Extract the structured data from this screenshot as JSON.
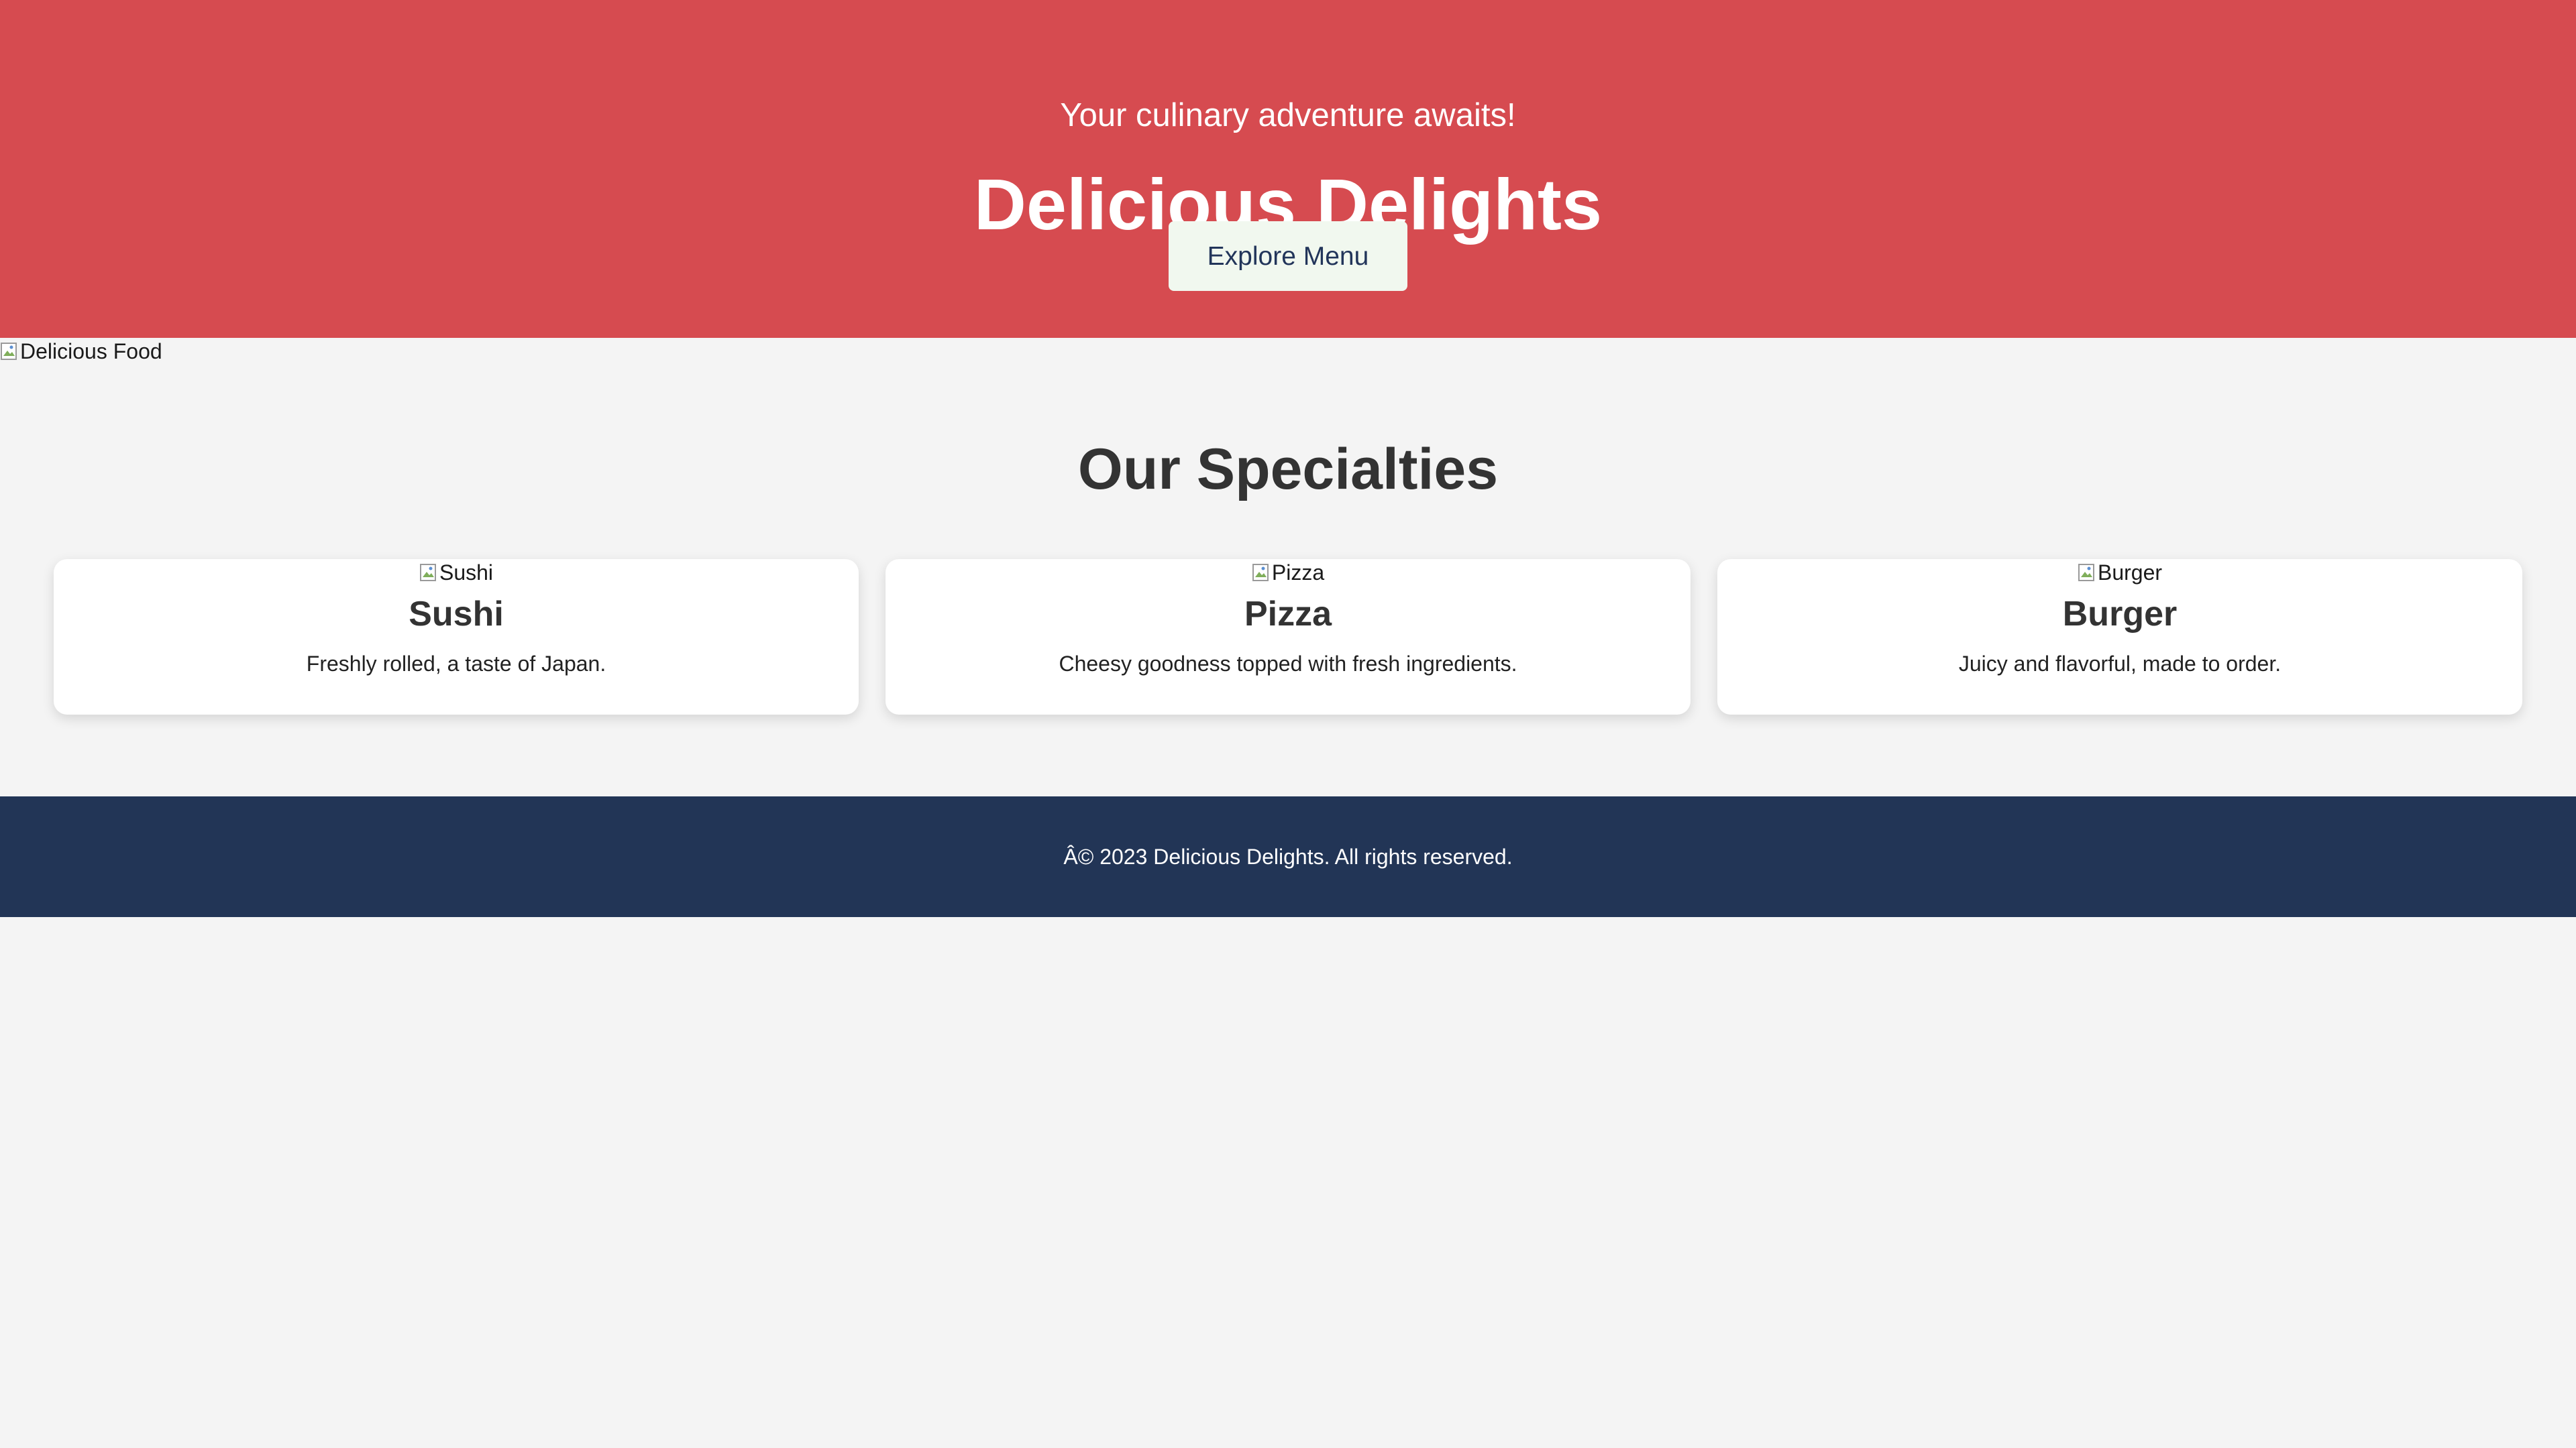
{
  "hero": {
    "tagline": "Your culinary adventure awaits!",
    "title": "Delicious Delights",
    "cta_label": "Explore Menu",
    "image_alt": "Delicious Food",
    "background_color": "#d64b50",
    "cta_background": "#f1f8ef",
    "cta_text_color": "#22355a"
  },
  "specialties": {
    "heading": "Our Specialties",
    "items": [
      {
        "image_alt": "Sushi",
        "name": "Sushi",
        "description": "Freshly rolled, a taste of Japan."
      },
      {
        "image_alt": "Pizza",
        "name": "Pizza",
        "description": "Cheesy goodness topped with fresh ingredients."
      },
      {
        "image_alt": "Burger",
        "name": "Burger",
        "description": "Juicy and flavorful, made to order."
      }
    ]
  },
  "footer": {
    "text": "Â© 2023 Delicious Delights. All rights reserved.",
    "background_color": "#223556"
  },
  "icons": {
    "broken_image": "broken-image-icon"
  }
}
